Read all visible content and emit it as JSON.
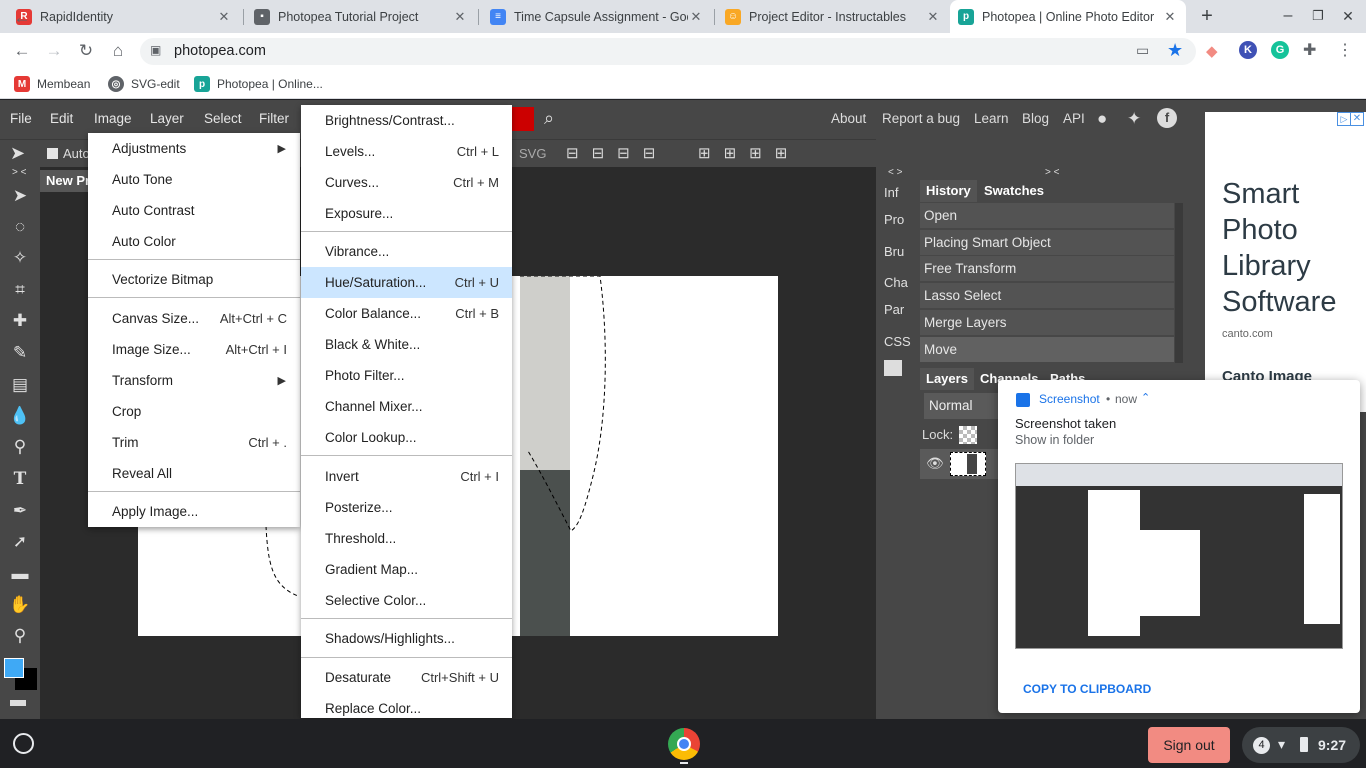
{
  "browser": {
    "tabs": [
      {
        "title": "RapidIdentity",
        "icon": "rapididentity-icon",
        "color": "#e53935",
        "active": false
      },
      {
        "title": "Photopea Tutorial Project",
        "icon": "document-icon",
        "color": "#5f6368",
        "active": false
      },
      {
        "title": "Time Capsule Assignment - Goo",
        "icon": "google-docs-icon",
        "color": "#4285f4",
        "active": false
      },
      {
        "title": "Project Editor - Instructables",
        "icon": "instructables-icon",
        "color": "#f9a825",
        "active": false
      },
      {
        "title": "Photopea | Online Photo Editor",
        "icon": "photopea-icon",
        "color": "#18a497",
        "active": true
      }
    ],
    "new_tab": "+",
    "url": "photopea.com",
    "bookmarks": [
      {
        "label": "Membean",
        "icon": "membean-icon"
      },
      {
        "label": "SVG-edit",
        "icon": "globe-icon"
      },
      {
        "label": "Photopea | Online...",
        "icon": "photopea-icon"
      }
    ]
  },
  "photopea": {
    "menubar": [
      "File",
      "Edit",
      "Image",
      "Layer",
      "Select",
      "Filter"
    ],
    "right_links": [
      "About",
      "Report a bug",
      "Learn",
      "Blog",
      "API"
    ],
    "options": {
      "auto_select": "Auto",
      "svg": "SVG"
    },
    "doc_tab": "New Pr",
    "collapse_left": "> <",
    "collapse_mid": "< >",
    "collapse_right": "> <",
    "side_labels": [
      "Inf",
      "Pro",
      "Bru",
      "Cha",
      "Par",
      "CSS"
    ],
    "history_tabs": [
      "History",
      "Swatches"
    ],
    "history_items": [
      "Open",
      "Placing Smart Object",
      "Free Transform",
      "Lasso Select",
      "Merge Layers",
      "Move"
    ],
    "layers_tabs": [
      "Layers",
      "Channels",
      "Paths"
    ],
    "blend_mode": "Normal",
    "lock_label": "Lock:",
    "colors": {
      "foreground": "#3fa9f5",
      "background": "#000000"
    }
  },
  "image_menu": {
    "items": [
      {
        "label": "Adjustments",
        "shortcut": "",
        "submenu": true
      },
      {
        "label": "Auto Tone",
        "shortcut": ""
      },
      {
        "label": "Auto Contrast",
        "shortcut": ""
      },
      {
        "label": "Auto Color",
        "shortcut": ""
      },
      {
        "label": "Vectorize Bitmap",
        "shortcut": ""
      },
      {
        "label": "Canvas Size...",
        "shortcut": "Alt+Ctrl + C"
      },
      {
        "label": "Image Size...",
        "shortcut": "Alt+Ctrl + I"
      },
      {
        "label": "Transform",
        "shortcut": "",
        "submenu": true
      },
      {
        "label": "Crop",
        "shortcut": ""
      },
      {
        "label": "Trim",
        "shortcut": "Ctrl + ."
      },
      {
        "label": "Reveal All",
        "shortcut": ""
      },
      {
        "label": "Apply Image...",
        "shortcut": ""
      }
    ]
  },
  "adjustments_menu": {
    "items": [
      {
        "label": "Brightness/Contrast...",
        "shortcut": ""
      },
      {
        "label": "Levels...",
        "shortcut": "Ctrl + L"
      },
      {
        "label": "Curves...",
        "shortcut": "Ctrl + M"
      },
      {
        "label": "Exposure...",
        "shortcut": ""
      },
      {
        "label": "Vibrance...",
        "shortcut": ""
      },
      {
        "label": "Hue/Saturation...",
        "shortcut": "Ctrl + U",
        "highlighted": true
      },
      {
        "label": "Color Balance...",
        "shortcut": "Ctrl + B"
      },
      {
        "label": "Black & White...",
        "shortcut": ""
      },
      {
        "label": "Photo Filter...",
        "shortcut": ""
      },
      {
        "label": "Channel Mixer...",
        "shortcut": ""
      },
      {
        "label": "Color Lookup...",
        "shortcut": ""
      },
      {
        "label": "Invert",
        "shortcut": "Ctrl + I"
      },
      {
        "label": "Posterize...",
        "shortcut": ""
      },
      {
        "label": "Threshold...",
        "shortcut": ""
      },
      {
        "label": "Gradient Map...",
        "shortcut": ""
      },
      {
        "label": "Selective Color...",
        "shortcut": ""
      },
      {
        "label": "Shadows/Highlights...",
        "shortcut": ""
      },
      {
        "label": "Desaturate",
        "shortcut": "Ctrl+Shift + U"
      },
      {
        "label": "Replace Color...",
        "shortcut": ""
      }
    ]
  },
  "ad": {
    "headline": "Smart Photo Library Software",
    "domain": "canto.com",
    "subhead": "Canto Image"
  },
  "notification": {
    "app": "Screenshot",
    "time": "now",
    "title": "Screenshot taken",
    "subtitle": "Show in folder",
    "action": "COPY TO CLIPBOARD"
  },
  "shelf": {
    "sign_out": "Sign out",
    "badge": "4",
    "time": "9:27"
  }
}
